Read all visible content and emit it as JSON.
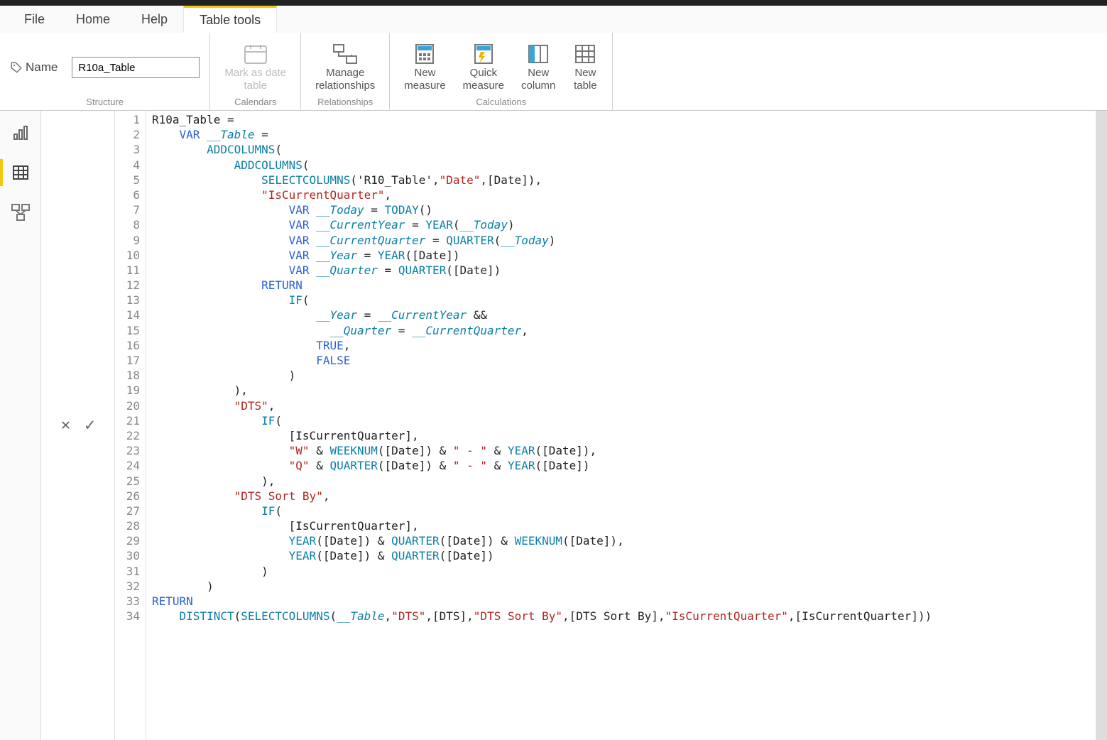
{
  "tabs": {
    "file": "File",
    "home": "Home",
    "help": "Help",
    "table_tools": "Table tools"
  },
  "ribbon": {
    "structure": {
      "name_label": "Name",
      "name_value": "R10a_Table",
      "group_label": "Structure"
    },
    "calendars": {
      "mark_as_date": "Mark as date\ntable",
      "group_label": "Calendars"
    },
    "relationships": {
      "manage": "Manage\nrelationships",
      "group_label": "Relationships"
    },
    "calculations": {
      "new_measure": "New\nmeasure",
      "quick_measure": "Quick\nmeasure",
      "new_column": "New\ncolumn",
      "new_table": "New\ntable",
      "group_label": "Calculations"
    }
  },
  "formula": {
    "cancel": "✕",
    "confirm": "✓"
  },
  "code": {
    "lines": [
      {
        "n": 1,
        "html": "R10a_Table = "
      },
      {
        "n": 2,
        "html": "    <span class='tk-kw'>VAR</span> <span class='tk-var'>__Table</span> = "
      },
      {
        "n": 3,
        "html": "        <span class='tk-fn'>ADDCOLUMNS</span>("
      },
      {
        "n": 4,
        "html": "            <span class='tk-fn'>ADDCOLUMNS</span>("
      },
      {
        "n": 5,
        "html": "                <span class='tk-fn'>SELECTCOLUMNS</span>('R10_Table',<span class='tk-str'>\"Date\"</span>,[Date]),"
      },
      {
        "n": 6,
        "html": "                <span class='tk-str'>\"IsCurrentQuarter\"</span>,"
      },
      {
        "n": 7,
        "html": "                    <span class='tk-kw'>VAR</span> <span class='tk-var'>__Today</span> = <span class='tk-fn'>TODAY</span>()"
      },
      {
        "n": 8,
        "html": "                    <span class='tk-kw'>VAR</span> <span class='tk-var'>__CurrentYear</span> = <span class='tk-fn'>YEAR</span>(<span class='tk-var'>__Today</span>)"
      },
      {
        "n": 9,
        "html": "                    <span class='tk-kw'>VAR</span> <span class='tk-var'>__CurrentQuarter</span> = <span class='tk-fn'>QUARTER</span>(<span class='tk-var'>__Today</span>)"
      },
      {
        "n": 10,
        "html": "                    <span class='tk-kw'>VAR</span> <span class='tk-var'>__Year</span> = <span class='tk-fn'>YEAR</span>([Date])"
      },
      {
        "n": 11,
        "html": "                    <span class='tk-kw'>VAR</span> <span class='tk-var'>__Quarter</span> = <span class='tk-fn'>QUARTER</span>([Date])"
      },
      {
        "n": 12,
        "html": "                <span class='tk-kw'>RETURN</span>"
      },
      {
        "n": 13,
        "html": "                    <span class='tk-fn'>IF</span>("
      },
      {
        "n": 14,
        "html": "                        <span class='tk-var'>__Year</span> = <span class='tk-var'>__CurrentYear</span> &amp;&amp;"
      },
      {
        "n": 15,
        "html": "                          <span class='tk-var'>__Quarter</span> = <span class='tk-var'>__CurrentQuarter</span>,"
      },
      {
        "n": 16,
        "html": "                        <span class='tk-kw'>TRUE</span>,"
      },
      {
        "n": 17,
        "html": "                        <span class='tk-kw'>FALSE</span>"
      },
      {
        "n": 18,
        "html": "                    )"
      },
      {
        "n": 19,
        "html": "            ),"
      },
      {
        "n": 20,
        "html": "            <span class='tk-str'>\"DTS\"</span>,"
      },
      {
        "n": 21,
        "html": "                <span class='tk-fn'>IF</span>("
      },
      {
        "n": 22,
        "html": "                    [IsCurrentQuarter],"
      },
      {
        "n": 23,
        "html": "                    <span class='tk-str'>\"W\"</span> &amp; <span class='tk-fn'>WEEKNUM</span>([Date]) &amp; <span class='tk-str'>\" - \"</span> &amp; <span class='tk-fn'>YEAR</span>([Date]),"
      },
      {
        "n": 24,
        "html": "                    <span class='tk-str'>\"Q\"</span> &amp; <span class='tk-fn'>QUARTER</span>([Date]) &amp; <span class='tk-str'>\" - \"</span> &amp; <span class='tk-fn'>YEAR</span>([Date])"
      },
      {
        "n": 25,
        "html": "                ),"
      },
      {
        "n": 26,
        "html": "            <span class='tk-str'>\"DTS Sort By\"</span>,"
      },
      {
        "n": 27,
        "html": "                <span class='tk-fn'>IF</span>("
      },
      {
        "n": 28,
        "html": "                    [IsCurrentQuarter],"
      },
      {
        "n": 29,
        "html": "                    <span class='tk-fn'>YEAR</span>([Date]) &amp; <span class='tk-fn'>QUARTER</span>([Date]) &amp; <span class='tk-fn'>WEEKNUM</span>([Date]),"
      },
      {
        "n": 30,
        "html": "                    <span class='tk-fn'>YEAR</span>([Date]) &amp; <span class='tk-fn'>QUARTER</span>([Date])"
      },
      {
        "n": 31,
        "html": "                )"
      },
      {
        "n": 32,
        "html": "        )"
      },
      {
        "n": 33,
        "html": "<span class='tk-kw'>RETURN</span>"
      },
      {
        "n": 34,
        "html": "    <span class='tk-fn'>DISTINCT</span>(<span class='tk-fn'>SELECTCOLUMNS</span>(<span class='tk-var'>__Table</span>,<span class='tk-str'>\"DTS\"</span>,[DTS],<span class='tk-str'>\"DTS Sort By\"</span>,[DTS Sort By],<span class='tk-str'>\"IsCurrentQuarter\"</span>,[IsCurrentQuarter]))"
      }
    ]
  }
}
